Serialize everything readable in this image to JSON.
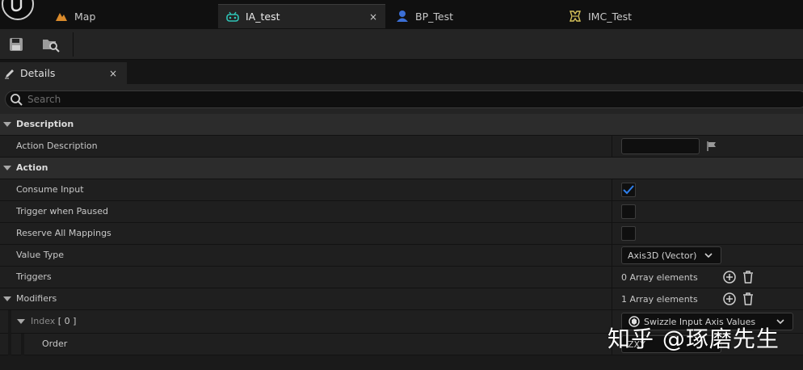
{
  "tabs": [
    {
      "label": "Map",
      "icon": "map-icon",
      "active": false
    },
    {
      "label": "IA_test",
      "icon": "input-action-icon",
      "active": true,
      "close": "×"
    },
    {
      "label": "BP_Test",
      "icon": "blueprint-icon",
      "active": false
    },
    {
      "label": "IMC_Test",
      "icon": "mapping-context-icon",
      "active": false
    }
  ],
  "toolbar": {
    "save_icon": "save-icon",
    "browse_icon": "browse-icon"
  },
  "details": {
    "tab_label": "Details",
    "close": "×"
  },
  "search": {
    "placeholder": "Search"
  },
  "sections": {
    "description": {
      "title": "Description",
      "action_description": {
        "label": "Action Description",
        "value": ""
      }
    },
    "action": {
      "title": "Action",
      "consume_input": {
        "label": "Consume Input",
        "checked": true
      },
      "trigger_when_paused": {
        "label": "Trigger when Paused",
        "checked": false
      },
      "reserve_all_mappings": {
        "label": "Reserve All Mappings",
        "checked": false
      },
      "value_type": {
        "label": "Value Type",
        "selected": "Axis3D (Vector)"
      },
      "triggers": {
        "label": "Triggers",
        "count_text": "0 Array elements"
      },
      "modifiers": {
        "label": "Modifiers",
        "count_text": "1 Array elements",
        "index_label": "Index",
        "index_value": "[ 0 ]",
        "modifier_selected": "Swizzle Input Axis Values",
        "order_label": "Order",
        "order_value": "ZXY"
      }
    }
  },
  "watermark": "知乎 @琢磨先生",
  "colors": {
    "accent": "#2f80ed",
    "background": "#1a1a1a",
    "panel": "#242424"
  }
}
